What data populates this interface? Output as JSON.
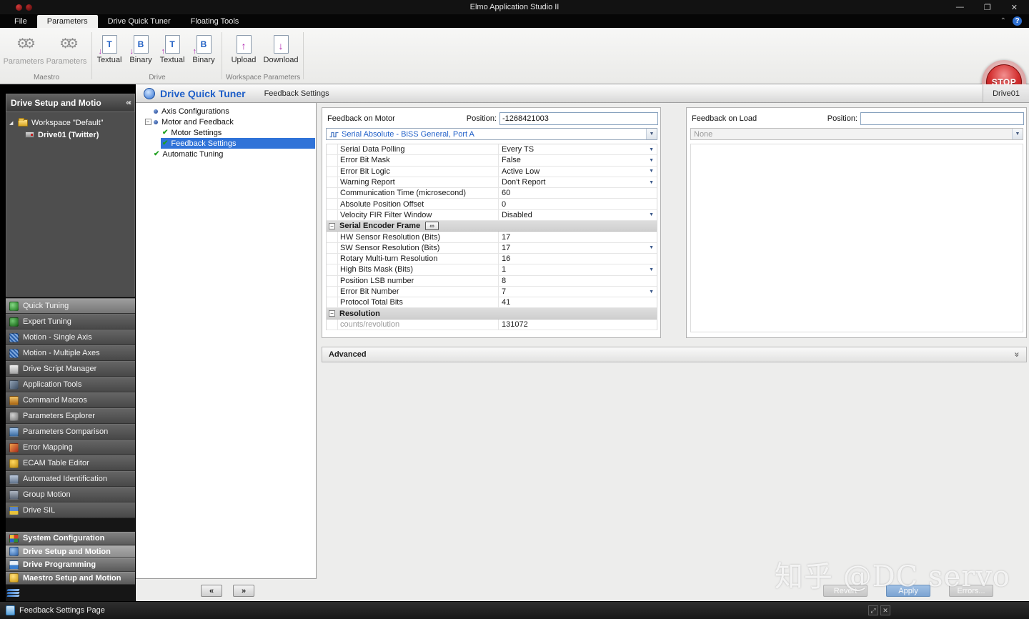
{
  "window": {
    "title": "Elmo Application Studio II"
  },
  "menubar": {
    "tabs": [
      {
        "label": "File"
      },
      {
        "label": "Parameters",
        "active": true
      },
      {
        "label": "Drive Quick Tuner"
      },
      {
        "label": "Floating Tools"
      }
    ],
    "help_label": "?"
  },
  "ribbon": {
    "maestro": {
      "label": "Maestro",
      "buttons": [
        {
          "label": "Parameters"
        },
        {
          "label": "Parameters"
        }
      ]
    },
    "drive": {
      "label": "Drive",
      "buttons": [
        {
          "label": "Textual",
          "letter": "T"
        },
        {
          "label": "Binary",
          "letter": "B"
        },
        {
          "label": "Textual",
          "letter": "T"
        },
        {
          "label": "Binary",
          "letter": "B"
        }
      ]
    },
    "workspace": {
      "label": "Workspace Parameters",
      "buttons": [
        {
          "label": "Upload",
          "arrow": "↑"
        },
        {
          "label": "Download",
          "arrow": "↓"
        }
      ]
    },
    "stop_label": "STOP"
  },
  "left_panel": {
    "header": "Drive Setup and Motio",
    "tree": {
      "workspace_label": "Workspace \"Default\"",
      "drive_label": "Drive01 (Twitter)"
    },
    "nav_items": [
      {
        "label": "Quick Tuning",
        "icon": "quick-tuning-icon",
        "selected": true
      },
      {
        "label": "Expert Tuning",
        "icon": "expert-tuning-icon"
      },
      {
        "label": "Motion - Single Axis",
        "icon": "motion-single-axis-icon"
      },
      {
        "label": "Motion - Multiple Axes",
        "icon": "motion-multiple-axes-icon"
      },
      {
        "label": "Drive Script Manager",
        "icon": "drive-script-manager-icon"
      },
      {
        "label": "Application Tools",
        "icon": "application-tools-icon"
      },
      {
        "label": "Command Macros",
        "icon": "command-macros-icon"
      },
      {
        "label": "Parameters Explorer",
        "icon": "parameters-explorer-icon"
      },
      {
        "label": "Parameters Comparison",
        "icon": "parameters-comparison-icon"
      },
      {
        "label": "Error Mapping",
        "icon": "error-mapping-icon"
      },
      {
        "label": "ECAM Table Editor",
        "icon": "ecam-table-editor-icon"
      },
      {
        "label": "Automated Identification",
        "icon": "automated-identification-icon"
      },
      {
        "label": "Group Motion",
        "icon": "group-motion-icon"
      },
      {
        "label": "Drive SIL",
        "icon": "drive-sil-icon"
      }
    ],
    "sections": [
      {
        "label": "System Configuration",
        "icon": "system-configuration-icon"
      },
      {
        "label": "Drive Setup and Motion",
        "icon": "drive-setup-motion-icon",
        "selected": true
      },
      {
        "label": "Drive Programming",
        "icon": "drive-programming-icon"
      },
      {
        "label": "Maestro Setup and Motion",
        "icon": "maestro-setup-motion-icon"
      }
    ]
  },
  "quick_tuner": {
    "title": "Drive Quick Tuner",
    "tab_label": "Feedback Settings",
    "drive_label": "Drive01",
    "tree": [
      {
        "label": "Axis Configurations",
        "bullet": true
      },
      {
        "label": "Motor and Feedback",
        "bullet": true,
        "expander": true
      },
      {
        "label": "Motor Settings",
        "check": true,
        "child": true
      },
      {
        "label": "Feedback Settings",
        "check": true,
        "child": true,
        "selected": true
      },
      {
        "label": "Automatic Tuning",
        "check": true
      }
    ]
  },
  "feedback_motor": {
    "title": "Feedback on Motor",
    "position_label": "Position:",
    "position_value": "-1268421003",
    "feedback_type": "Serial Absolute - BiSS General, Port A",
    "rows": [
      {
        "label": "Serial Data Polling",
        "value": "Every TS",
        "dropdown": true
      },
      {
        "label": "Error Bit Mask",
        "value": "False",
        "dropdown": true
      },
      {
        "label": "Error Bit Logic",
        "value": "Active Low",
        "dropdown": true
      },
      {
        "label": "Warning Report",
        "value": "Don't Report",
        "dropdown": true
      },
      {
        "label": "Communication Time (microsecond)",
        "value": "60"
      },
      {
        "label": "Absolute Position Offset",
        "value": "0"
      },
      {
        "label": "Velocity FIR Filter Window",
        "value": "Disabled",
        "dropdown": true
      },
      {
        "label": "Serial Encoder Frame",
        "section": true,
        "tool": true
      },
      {
        "label": "HW Sensor Resolution (Bits)",
        "value": "17"
      },
      {
        "label": "SW Sensor Resolution (Bits)",
        "value": "17",
        "dropdown": true
      },
      {
        "label": "Rotary Multi-turn Resolution",
        "value": "16"
      },
      {
        "label": "High Bits Mask (Bits)",
        "value": "1",
        "dropdown": true
      },
      {
        "label": "Position LSB number",
        "value": "8"
      },
      {
        "label": "Error Bit Number",
        "value": "7",
        "dropdown": true
      },
      {
        "label": "Protocol Total Bits",
        "value": "41"
      },
      {
        "label": "Resolution",
        "section": true
      },
      {
        "label": "counts/revolution",
        "value": "131072",
        "muted": true
      }
    ]
  },
  "feedback_load": {
    "title": "Feedback on Load",
    "position_label": "Position:",
    "position_value": "",
    "feedback_type": "None"
  },
  "advanced_label": "Advanced",
  "footer_buttons": [
    {
      "label": "Revert"
    },
    {
      "label": "Apply",
      "accent": true
    },
    {
      "label": "Errors..."
    }
  ],
  "statusbar": {
    "label": "Feedback Settings Page"
  },
  "watermark": "知乎 @DC servo"
}
